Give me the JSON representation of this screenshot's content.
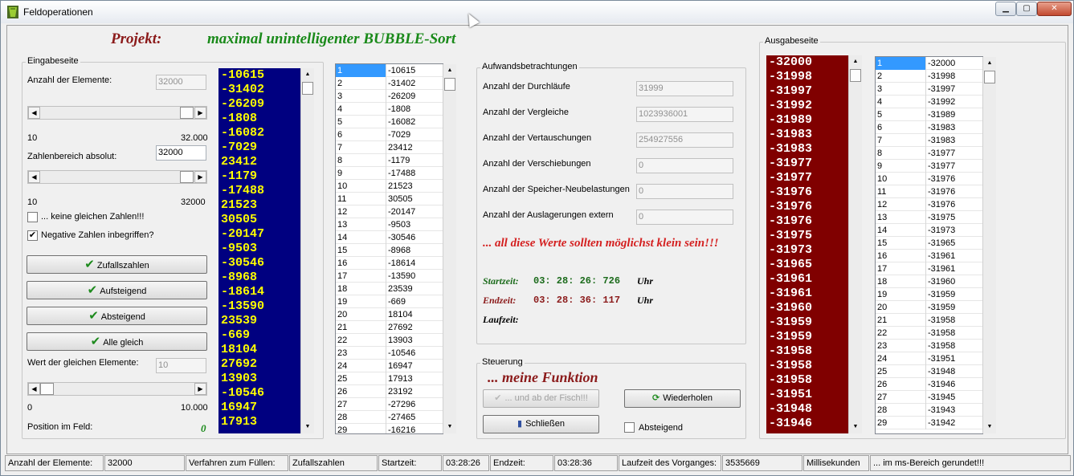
{
  "window": {
    "title": "Feldoperationen"
  },
  "project": {
    "label": "Projekt:",
    "name": "maximal unintelligenter BUBBLE-Sort"
  },
  "input": {
    "legend": "Eingabeseite",
    "count_label": "Anzahl der Elemente:",
    "count_value": "32000",
    "count_min": "10",
    "count_max": "32.000",
    "range_label": "Zahlenbereich absolut:",
    "range_value": "32000",
    "range_min": "10",
    "range_max": "32000",
    "no_equal_label": "... keine gleichen Zahlen!!!",
    "no_equal_checked": false,
    "negative_label": "Negative Zahlen inbegriffen?",
    "negative_checked": true,
    "btn_random": "Zufallszahlen",
    "btn_asc": "Aufsteigend",
    "btn_desc": "Absteigend",
    "btn_equal": "Alle gleich",
    "equal_value_label": "Wert der gleichen Elemente:",
    "equal_value": "10",
    "equal_min": "0",
    "equal_max": "10.000",
    "position_label": "Position im Feld:",
    "position_value": "0",
    "big_values": [
      "-10615",
      "-31402",
      "-26209",
      "-1808",
      "-16082",
      "-7029",
      "23412",
      "-1179",
      "-17488",
      "21523",
      "30505",
      "-20147",
      "-9503",
      "-30546",
      "-8968",
      "-18614",
      "-13590",
      "23539",
      "-669",
      "18104",
      "27692",
      "13903",
      "-10546",
      "16947",
      "17913"
    ],
    "list_rows": [
      [
        "1",
        "-10615"
      ],
      [
        "2",
        "-31402"
      ],
      [
        "3",
        "-26209"
      ],
      [
        "4",
        "-1808"
      ],
      [
        "5",
        "-16082"
      ],
      [
        "6",
        "-7029"
      ],
      [
        "7",
        "23412"
      ],
      [
        "8",
        "-1179"
      ],
      [
        "9",
        "-17488"
      ],
      [
        "10",
        "21523"
      ],
      [
        "11",
        "30505"
      ],
      [
        "12",
        "-20147"
      ],
      [
        "13",
        "-9503"
      ],
      [
        "14",
        "-30546"
      ],
      [
        "15",
        "-8968"
      ],
      [
        "16",
        "-18614"
      ],
      [
        "17",
        "-13590"
      ],
      [
        "18",
        "23539"
      ],
      [
        "19",
        "-669"
      ],
      [
        "20",
        "18104"
      ],
      [
        "21",
        "27692"
      ],
      [
        "22",
        "13903"
      ],
      [
        "23",
        "-10546"
      ],
      [
        "24",
        "16947"
      ],
      [
        "25",
        "17913"
      ],
      [
        "26",
        "23192"
      ],
      [
        "27",
        "-27296"
      ],
      [
        "28",
        "-27465"
      ],
      [
        "29",
        "-16216"
      ]
    ]
  },
  "effort": {
    "legend": "Aufwandsbetrachtungen",
    "runs_label": "Anzahl der Durchläufe",
    "runs_value": "31999",
    "compare_label": "Anzahl der Vergleiche",
    "compare_value": "1023936001",
    "swap_label": "Anzahl der Vertauschungen",
    "swap_value": "254927556",
    "shift_label": "Anzahl der Verschiebungen",
    "shift_value": "0",
    "mem_label": "Anzahl der Speicher-Neubelastungen",
    "mem_value": "0",
    "ext_label": "Anzahl der Auslagerungen extern",
    "ext_value": "0",
    "hint": "... all diese Werte sollten möglichst klein sein!!!",
    "start_label": "Startzeit:",
    "start_value": "03: 28: 26: 726",
    "start_unit": "Uhr",
    "end_label": "Endzeit:",
    "end_value": "03: 28: 36: 117",
    "end_unit": "Uhr",
    "run_label": "Laufzeit:"
  },
  "control": {
    "legend": "Steuerung",
    "func_title": "... meine Funktion",
    "btn_fish": "... und ab der Fisch!!!",
    "btn_repeat": "Wiederholen",
    "btn_close": "Schließen",
    "desc_label": "Absteigend",
    "desc_checked": false
  },
  "output": {
    "legend": "Ausgabeseite",
    "big_values": [
      "-32000",
      "-31998",
      "-31997",
      "-31992",
      "-31989",
      "-31983",
      "-31983",
      "-31977",
      "-31977",
      "-31976",
      "-31976",
      "-31976",
      "-31975",
      "-31973",
      "-31965",
      "-31961",
      "-31961",
      "-31960",
      "-31959",
      "-31959",
      "-31958",
      "-31958",
      "-31958",
      "-31951",
      "-31948",
      "-31946"
    ],
    "list_rows": [
      [
        "1",
        "-32000"
      ],
      [
        "2",
        "-31998"
      ],
      [
        "3",
        "-31997"
      ],
      [
        "4",
        "-31992"
      ],
      [
        "5",
        "-31989"
      ],
      [
        "6",
        "-31983"
      ],
      [
        "7",
        "-31983"
      ],
      [
        "8",
        "-31977"
      ],
      [
        "9",
        "-31977"
      ],
      [
        "10",
        "-31976"
      ],
      [
        "11",
        "-31976"
      ],
      [
        "12",
        "-31976"
      ],
      [
        "13",
        "-31975"
      ],
      [
        "14",
        "-31973"
      ],
      [
        "15",
        "-31965"
      ],
      [
        "16",
        "-31961"
      ],
      [
        "17",
        "-31961"
      ],
      [
        "18",
        "-31960"
      ],
      [
        "19",
        "-31959"
      ],
      [
        "20",
        "-31959"
      ],
      [
        "21",
        "-31958"
      ],
      [
        "22",
        "-31958"
      ],
      [
        "23",
        "-31958"
      ],
      [
        "24",
        "-31951"
      ],
      [
        "25",
        "-31948"
      ],
      [
        "26",
        "-31946"
      ],
      [
        "27",
        "-31945"
      ],
      [
        "28",
        "-31943"
      ],
      [
        "29",
        "-31942"
      ]
    ]
  },
  "status": {
    "count_label": "Anzahl der Elemente:",
    "count_value": "32000",
    "fill_label": "Verfahren zum Füllen:",
    "fill_value": "Zufallszahlen",
    "start_label": "Startzeit:",
    "start_value": "03:28:26",
    "end_label": "Endzeit:",
    "end_value": "03:28:36",
    "run_label": "Laufzeit des Vorganges:",
    "run_value": "3535669",
    "unit": "Millisekunden",
    "note": "... im ms-Bereich gerundet!!!"
  },
  "colors": {
    "input_column_bg": "#000080",
    "input_column_fg": "#ffff00",
    "output_column_bg": "#800000",
    "output_column_fg": "#ffffff",
    "start_time": "#1a6a1a",
    "end_time": "#8b1a1a",
    "hint": "#d42020"
  }
}
